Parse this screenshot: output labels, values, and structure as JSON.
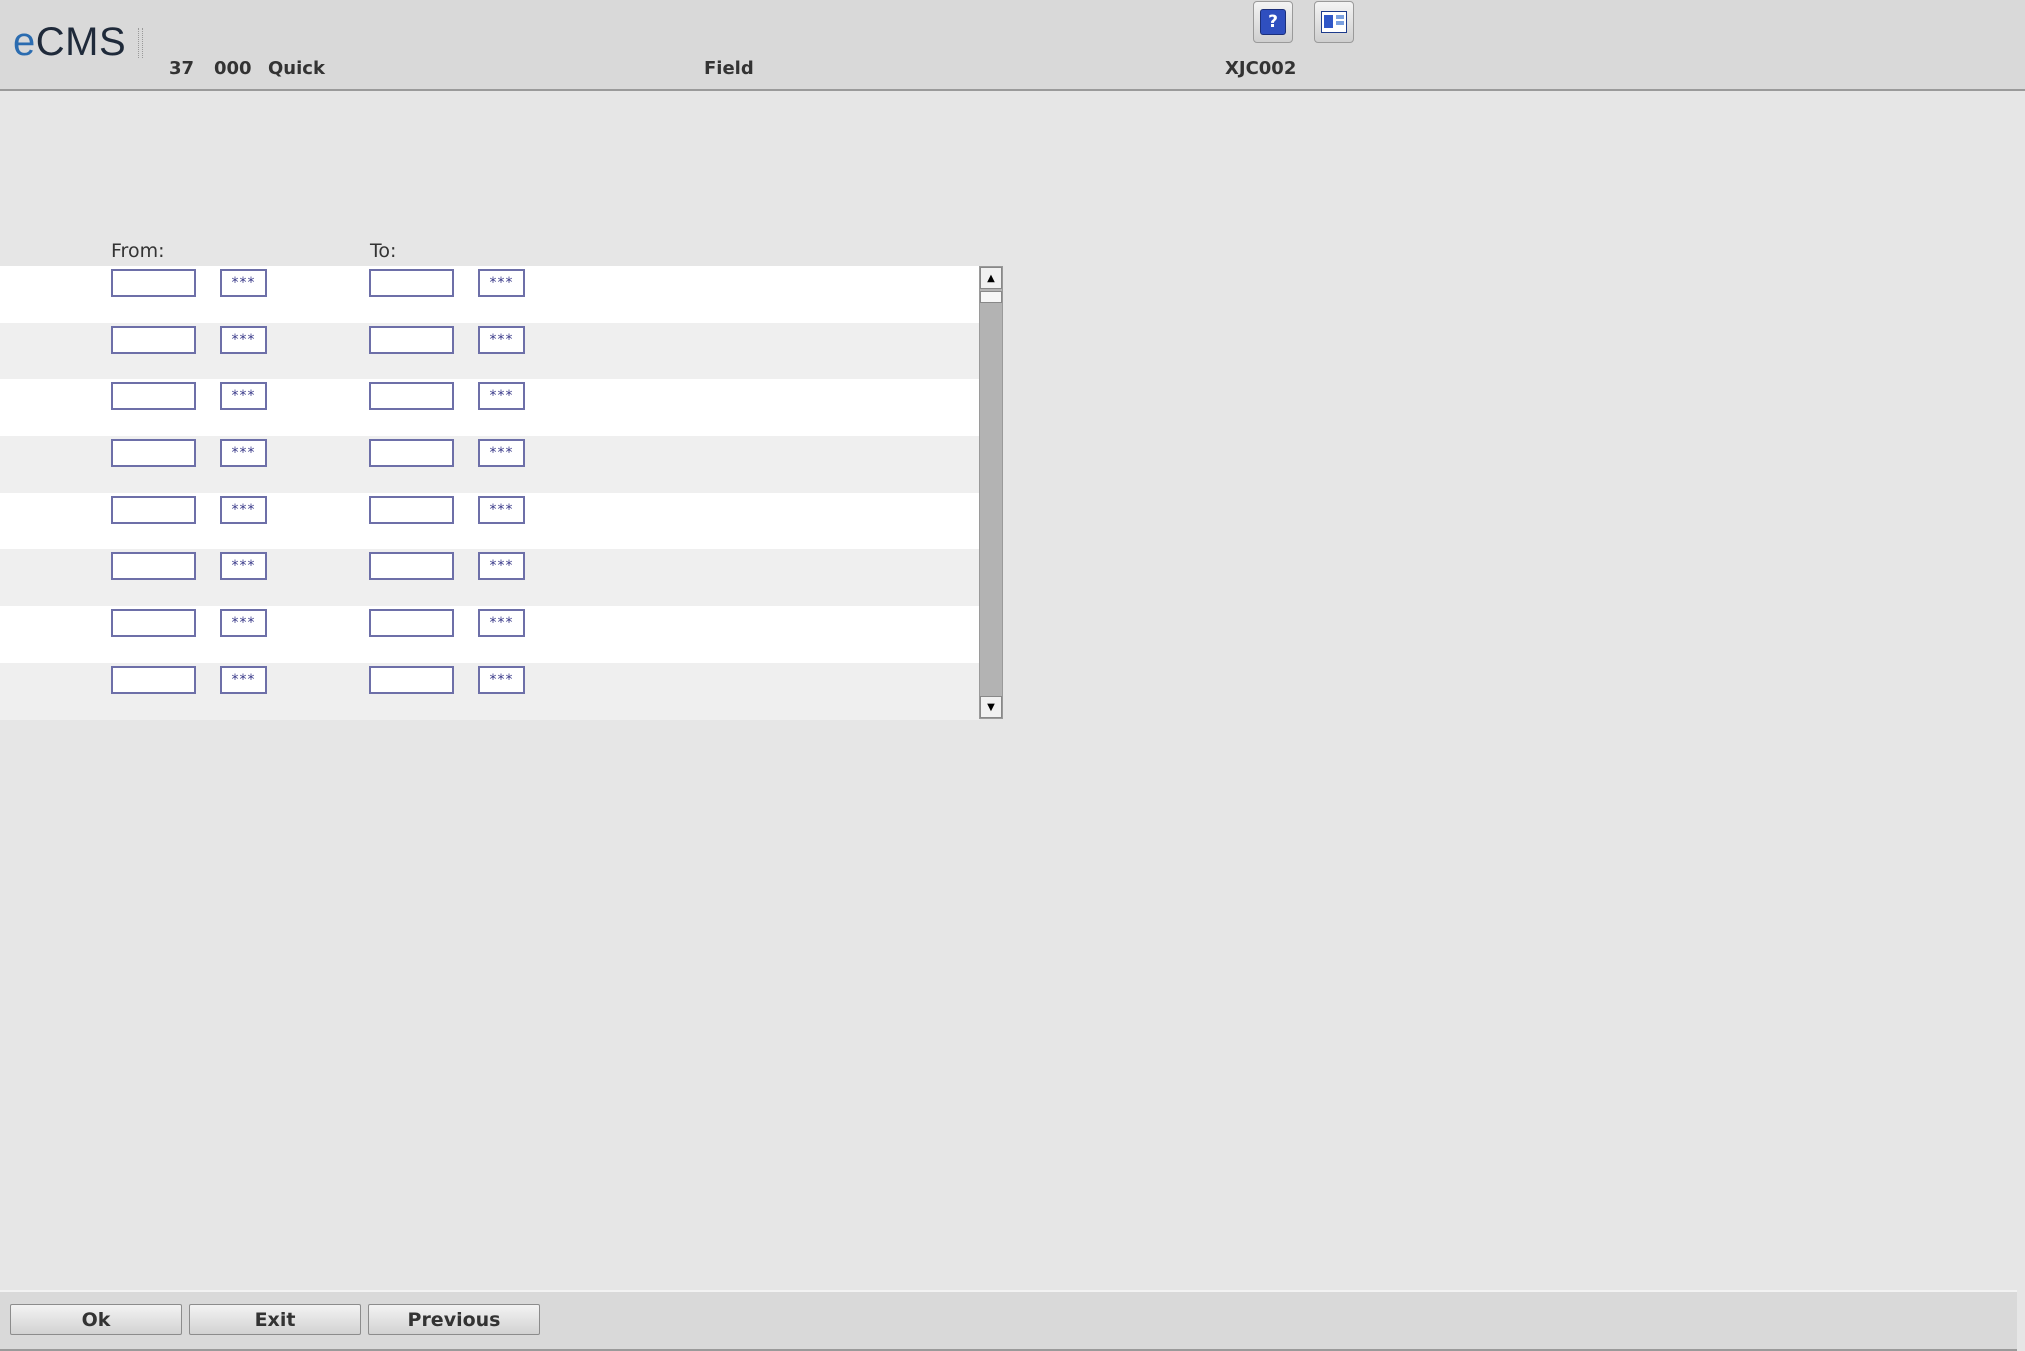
{
  "header": {
    "logo_e": "e",
    "logo_rest": "CMS",
    "company": "37",
    "division": "000",
    "menu": "Quick",
    "title": "Field",
    "program": "XJC002",
    "help_label": "?"
  },
  "labels": {
    "from": "From:",
    "to": "To:"
  },
  "lookup_text": "***",
  "rows": [
    {
      "from_value": "",
      "to_value": ""
    },
    {
      "from_value": "",
      "to_value": ""
    },
    {
      "from_value": "",
      "to_value": ""
    },
    {
      "from_value": "",
      "to_value": ""
    },
    {
      "from_value": "",
      "to_value": ""
    },
    {
      "from_value": "",
      "to_value": ""
    },
    {
      "from_value": "",
      "to_value": ""
    },
    {
      "from_value": "",
      "to_value": ""
    }
  ],
  "scrollbar": {
    "up": "▲",
    "down": "▼"
  },
  "footer": {
    "ok": "Ok",
    "exit": "Exit",
    "previous": "Previous"
  },
  "icons": [
    "help-icon",
    "window-icon",
    "scroll-up-icon",
    "scroll-down-icon"
  ]
}
